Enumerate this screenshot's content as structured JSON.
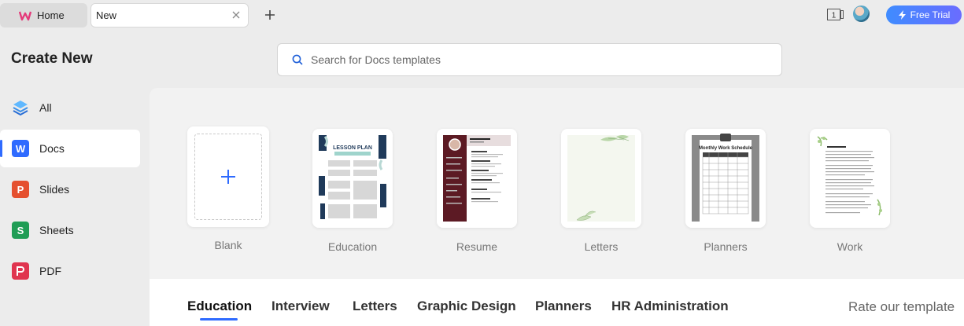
{
  "tabs": {
    "home_label": "Home",
    "new_label": "New"
  },
  "topbar": {
    "window_badge": "1",
    "free_trial_label": "Free Trial"
  },
  "sidebar": {
    "title": "Create New",
    "items": [
      {
        "label": "All",
        "icon": "all-layers-icon"
      },
      {
        "label": "Docs",
        "icon": "docs-icon"
      },
      {
        "label": "Slides",
        "icon": "slides-icon"
      },
      {
        "label": "Sheets",
        "icon": "sheets-icon"
      },
      {
        "label": "PDF",
        "icon": "pdf-icon"
      }
    ],
    "active": "Docs"
  },
  "search": {
    "placeholder": "Search for Docs templates"
  },
  "templates": [
    {
      "label": "Blank"
    },
    {
      "label": "Education"
    },
    {
      "label": "Resume"
    },
    {
      "label": "Letters"
    },
    {
      "label": "Planners"
    },
    {
      "label": "Work"
    }
  ],
  "category_tabs": [
    {
      "label": "Education"
    },
    {
      "label": "Interview"
    },
    {
      "label": "Letters"
    },
    {
      "label": "Graphic Design"
    },
    {
      "label": "Planners"
    },
    {
      "label": "HR Administration"
    }
  ],
  "active_category": "Education",
  "rate_label": "Rate our template",
  "colors": {
    "accent": "#2f6bff",
    "docs": "#2f6bff",
    "slides": "#e5502f",
    "sheets": "#1f9d55",
    "pdf": "#e0344f"
  }
}
